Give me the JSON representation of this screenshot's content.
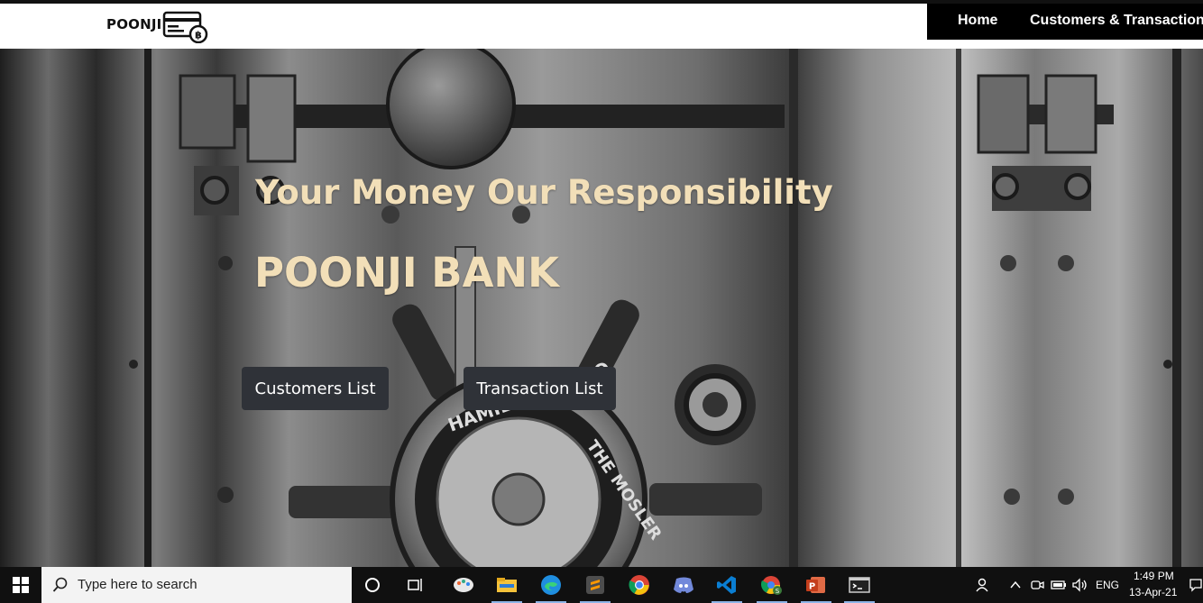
{
  "nav": {
    "brand": "POONJI",
    "links": [
      "Home",
      "Customers & Transactions"
    ]
  },
  "hero": {
    "tagline": "Your Money Our Responsibility",
    "title": "POONJI BANK",
    "buttons": [
      "Customers List",
      "Transaction List"
    ],
    "vault_text": [
      "HAMILTON, OHIO",
      "THE MOSLER"
    ]
  },
  "taskbar": {
    "search_placeholder": "Type here to search",
    "language": "ENG",
    "time": "1:49 PM",
    "date": "13-Apr-21",
    "apps": [
      "task-view-icon",
      "paint-icon",
      "file-explorer-icon",
      "edge-icon",
      "sublime-icon",
      "chrome-icon",
      "discord-icon",
      "vscode-icon",
      "chrome-profile-icon",
      "powerpoint-icon",
      "terminal-icon"
    ]
  },
  "colors": {
    "accent_text": "#f2dfb8",
    "button_bg": "#2f3238",
    "nav_bg": "#000000"
  }
}
